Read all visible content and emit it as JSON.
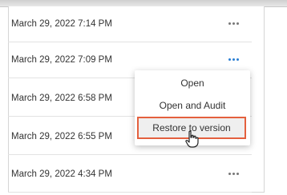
{
  "versions": [
    {
      "date": "March 29, 2022 7:14 PM"
    },
    {
      "date": "March 29, 2022 7:09 PM"
    },
    {
      "date": "March 29, 2022 6:58 PM"
    },
    {
      "date": "March 29, 2022 6:55 PM"
    },
    {
      "date": "March 29, 2022 4:34 PM"
    }
  ],
  "menu": {
    "open": "Open",
    "open_and_audit": "Open and Audit",
    "restore": "Restore to version"
  },
  "colors": {
    "highlight_border": "#e4603e",
    "active_more": "#2a7fd4"
  },
  "icons": {
    "more": "more-options-icon",
    "cursor": "hand-pointer-icon"
  }
}
